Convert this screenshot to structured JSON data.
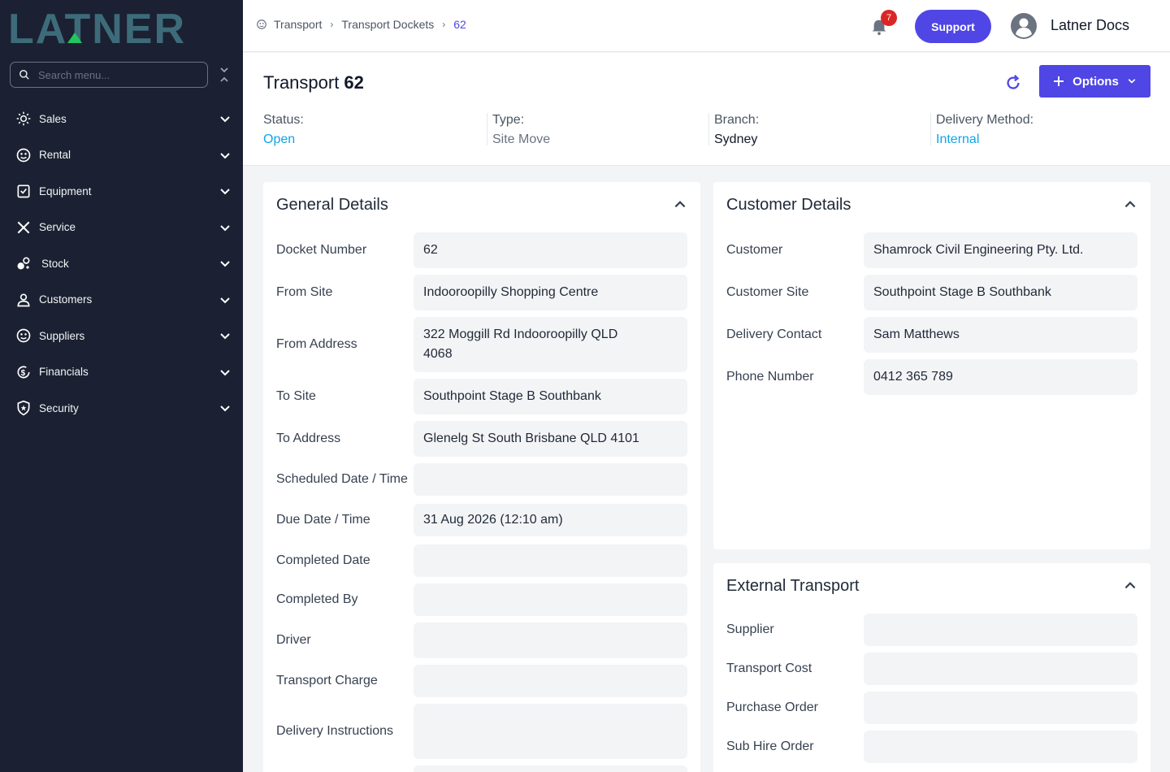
{
  "sidebar": {
    "logo_text": "LATNER",
    "search_placeholder": "Search menu...",
    "items": [
      {
        "label": "Sales",
        "icon": "sales-icon"
      },
      {
        "label": "Rental",
        "icon": "rental-icon"
      },
      {
        "label": "Equipment",
        "icon": "equipment-icon"
      },
      {
        "label": "Service",
        "icon": "service-icon"
      },
      {
        "label": "Stock",
        "icon": "stock-icon"
      },
      {
        "label": "Customers",
        "icon": "customers-icon"
      },
      {
        "label": "Suppliers",
        "icon": "suppliers-icon"
      },
      {
        "label": "Financials",
        "icon": "financials-icon"
      },
      {
        "label": "Security",
        "icon": "security-icon"
      }
    ]
  },
  "header": {
    "breadcrumb": [
      "Transport",
      "Transport Dockets",
      "62"
    ],
    "notification_count": "7",
    "support_label": "Support",
    "user_name": "Latner Docs"
  },
  "page": {
    "title": "Transport",
    "number": "62",
    "options_label": "Options",
    "meta": {
      "status_label": "Status:",
      "status_value": "Open",
      "type_label": "Type:",
      "type_value": "Site Move",
      "branch_label": "Branch:",
      "branch_value": "Sydney",
      "delivery_label": "Delivery Method:",
      "delivery_value": "Internal"
    }
  },
  "general": {
    "title": "General Details",
    "fields": [
      {
        "label": "Docket Number",
        "value": "62"
      },
      {
        "label": "From Site",
        "value": "Indooroopilly Shopping Centre"
      },
      {
        "label": "From Address",
        "value": "322 Moggill Rd Indooroopilly QLD 4068"
      },
      {
        "label": "To Site",
        "value": "Southpoint Stage B Southbank"
      },
      {
        "label": "To Address",
        "value": "Glenelg St South Brisbane QLD 4101"
      },
      {
        "label": "Scheduled Date / Time",
        "value": ""
      },
      {
        "label": "Due Date / Time",
        "value": "31 Aug 2026 (12:10 am)"
      },
      {
        "label": "Completed Date",
        "value": ""
      },
      {
        "label": "Completed By",
        "value": ""
      },
      {
        "label": "Driver",
        "value": ""
      },
      {
        "label": "Transport Charge",
        "value": ""
      },
      {
        "label": "Delivery Instructions",
        "value": ""
      }
    ]
  },
  "customer": {
    "title": "Customer Details",
    "fields": [
      {
        "label": "Customer",
        "value": "Shamrock Civil Engineering Pty. Ltd."
      },
      {
        "label": "Customer Site",
        "value": "Southpoint Stage B Southbank"
      },
      {
        "label": "Delivery Contact",
        "value": "Sam Matthews"
      },
      {
        "label": "Phone Number",
        "value": "0412 365 789"
      }
    ]
  },
  "external": {
    "title": "External Transport",
    "fields": [
      {
        "label": "Supplier",
        "value": ""
      },
      {
        "label": "Transport Cost",
        "value": ""
      },
      {
        "label": "Purchase Order",
        "value": ""
      },
      {
        "label": "Sub Hire Order",
        "value": ""
      }
    ]
  },
  "colors": {
    "accent": "#4f46e5",
    "link": "#0ea5e9",
    "sidebar": "#1b2132",
    "logo": "#3d6b7a"
  }
}
